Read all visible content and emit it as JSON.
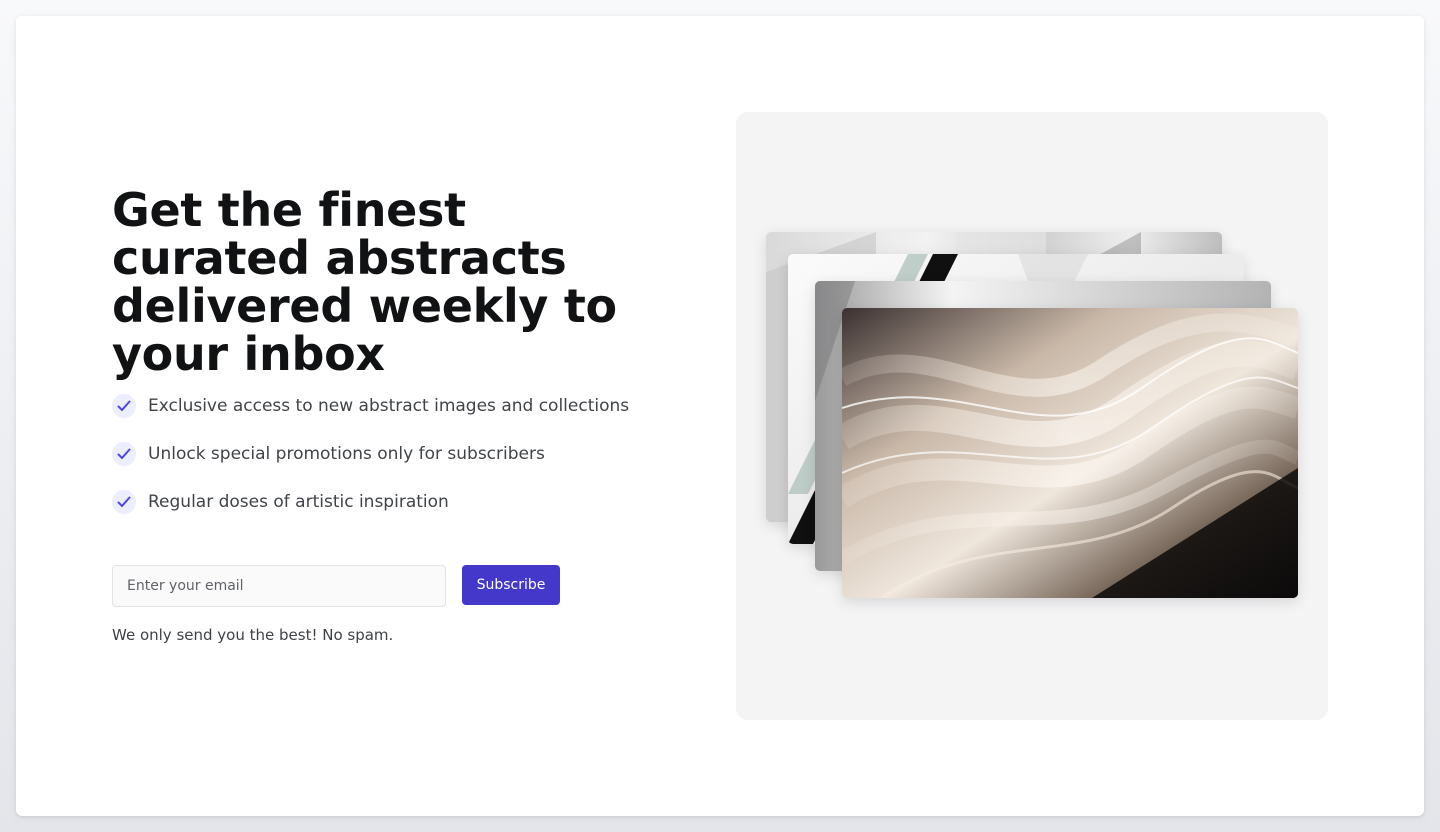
{
  "hero": {
    "headline": "Get the finest curated abstracts delivered weekly to your inbox",
    "features": [
      "Exclusive access to new abstract images and collections",
      "Unlock special promotions only for subscribers",
      "Regular doses of artistic inspiration"
    ]
  },
  "form": {
    "email_placeholder": "Enter your email",
    "subscribe_label": "Subscribe",
    "note": "We only send you the best! No spam."
  },
  "colors": {
    "accent": "#4338ca",
    "check_bg": "#eceefd",
    "check_mark": "#4f46e5"
  }
}
